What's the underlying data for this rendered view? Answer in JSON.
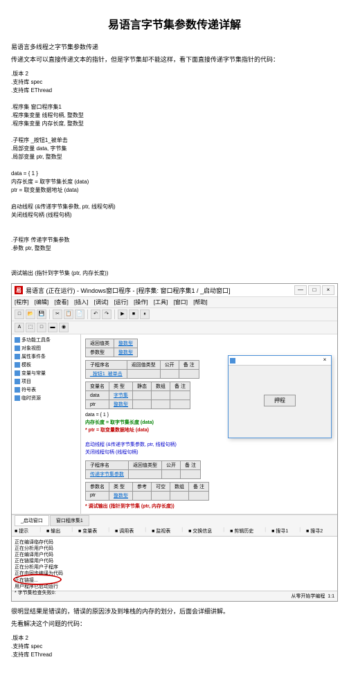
{
  "title": "易语言字节集参数传递详解",
  "intro1": "易语言多线程之字节集参数传递",
  "intro2": "传递文本可以直接传递文本的指针，但是字节集却不能这样，看下面直接传递字节集指针的代码：",
  "code1": ".版本 2\n.支持库 spec\n.支持库 EThread\n\n.程序集 窗口程序集1\n.程序集变量 线程句柄, 整数型\n.程序集变量 内存长度, 整数型\n\n.子程序 _按钮1_被单击\n.局部变量 data, 字节集\n.局部变量 ptr, 整数型\n\ndata = { 1 }\n内存长度 = 取字节集长度 (data)\nptr = 取变量数据地址 (data)\n\n启动线程 (&传递字节集参数, ptr, 线程句柄)\n关闭线程句柄 (线程句柄)\n\n\n.子程序 传递字节集参数\n.参数 ptr, 整数型\n\n\n调试输出 (指针到字节集 (ptr, 内存长度))",
  "ide": {
    "title": "易语言 (正在运行) - Windows窗口程序 - [程序集: 窗口程序集1 / _启动窗口]",
    "menus": [
      "[程序]",
      "[编辑]",
      "[查看]",
      "[插入]",
      "[调试]",
      "[运行]",
      "[操作]",
      "[工具]",
      "[窗口]",
      "[帮助]"
    ],
    "tree": [
      "多功能工具条",
      "对象视图",
      "属性事件条",
      "模板",
      "变量与常量",
      "项目",
      "符号表",
      "临时资源"
    ],
    "tablesHeader1": [
      "返回值类",
      "整数型"
    ],
    "tablesHeader2": [
      "参数型",
      "整数型"
    ],
    "subName": "子程序名",
    "retType": "返回值类型",
    "pub": "公开",
    "note": "备 注",
    "btn1": "_按钮1_被单击",
    "varName": "变量名",
    "type": "类 型",
    "static": "静态",
    "arr": "数组",
    "dataVar": "data",
    "dataType": "字节集",
    "ptrVar": "ptr",
    "ptrType": "整数型",
    "codeLines": {
      "l1": "data = { 1 }",
      "l2": "内存长度 = 取字节集长度 (data)",
      "l3": "ptr = 取变量数据地址 (data)",
      "l4": "启动线程 (&传递字节集参数, ptr, 线程句柄)",
      "l5": "关闭线程句柄 (线程句柄)"
    },
    "sub2": "传递字节集参数",
    "paramName": "参数名",
    "paramPtr": "ptr",
    "ref": "参考",
    "optional": "可空",
    "debugOut": "调试输出 (指针到字节集 (ptr, 内存长度))",
    "popupBtn": "押程",
    "tabs": [
      "_启动窗口",
      "窗口程序集1"
    ],
    "bottomTabs": [
      "提示",
      "输出",
      "变量表",
      "调用表",
      "监视表",
      "交换信息",
      "剪辑历史",
      "搜寻1",
      "搜寻2"
    ],
    "output": [
      "正在编译临存代码",
      "正在分析用户代码",
      "正在编译用户代码",
      "正在链接用户代码",
      "正在分析用户子程序",
      "正在由同步编译为代码",
      "正在链接...",
      "用户程序已启动运行",
      "字节集检查失败0:"
    ],
    "footer": "从零开始学编程",
    "footerPos": "1:1"
  },
  "outro1": "很明显结果是错误的，错误的原因涉及到堆栈的内存的划分，后面会详细讲解。",
  "outro2": "先看解决这个问题的代码：",
  "code2": ".版本 2\n.支持库 spec\n.支持库 EThread"
}
